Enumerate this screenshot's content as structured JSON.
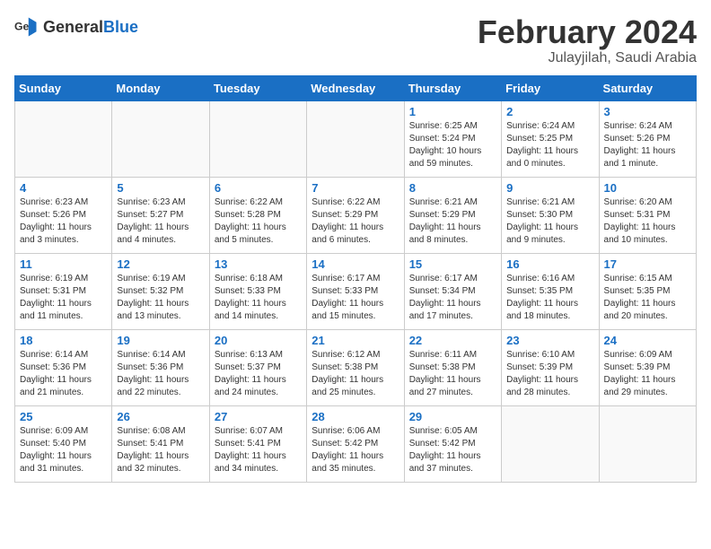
{
  "header": {
    "logo": {
      "general": "General",
      "blue": "Blue"
    },
    "title": "February 2024",
    "location": "Julayjilah, Saudi Arabia"
  },
  "weekdays": [
    "Sunday",
    "Monday",
    "Tuesday",
    "Wednesday",
    "Thursday",
    "Friday",
    "Saturday"
  ],
  "weeks": [
    [
      {
        "day": null
      },
      {
        "day": null
      },
      {
        "day": null
      },
      {
        "day": null
      },
      {
        "day": 1,
        "sunrise": "6:25 AM",
        "sunset": "5:24 PM",
        "daylight": "10 hours and 59 minutes."
      },
      {
        "day": 2,
        "sunrise": "6:24 AM",
        "sunset": "5:25 PM",
        "daylight": "11 hours and 0 minutes."
      },
      {
        "day": 3,
        "sunrise": "6:24 AM",
        "sunset": "5:26 PM",
        "daylight": "11 hours and 1 minute."
      }
    ],
    [
      {
        "day": 4,
        "sunrise": "6:23 AM",
        "sunset": "5:26 PM",
        "daylight": "11 hours and 3 minutes."
      },
      {
        "day": 5,
        "sunrise": "6:23 AM",
        "sunset": "5:27 PM",
        "daylight": "11 hours and 4 minutes."
      },
      {
        "day": 6,
        "sunrise": "6:22 AM",
        "sunset": "5:28 PM",
        "daylight": "11 hours and 5 minutes."
      },
      {
        "day": 7,
        "sunrise": "6:22 AM",
        "sunset": "5:29 PM",
        "daylight": "11 hours and 6 minutes."
      },
      {
        "day": 8,
        "sunrise": "6:21 AM",
        "sunset": "5:29 PM",
        "daylight": "11 hours and 8 minutes."
      },
      {
        "day": 9,
        "sunrise": "6:21 AM",
        "sunset": "5:30 PM",
        "daylight": "11 hours and 9 minutes."
      },
      {
        "day": 10,
        "sunrise": "6:20 AM",
        "sunset": "5:31 PM",
        "daylight": "11 hours and 10 minutes."
      }
    ],
    [
      {
        "day": 11,
        "sunrise": "6:19 AM",
        "sunset": "5:31 PM",
        "daylight": "11 hours and 11 minutes."
      },
      {
        "day": 12,
        "sunrise": "6:19 AM",
        "sunset": "5:32 PM",
        "daylight": "11 hours and 13 minutes."
      },
      {
        "day": 13,
        "sunrise": "6:18 AM",
        "sunset": "5:33 PM",
        "daylight": "11 hours and 14 minutes."
      },
      {
        "day": 14,
        "sunrise": "6:17 AM",
        "sunset": "5:33 PM",
        "daylight": "11 hours and 15 minutes."
      },
      {
        "day": 15,
        "sunrise": "6:17 AM",
        "sunset": "5:34 PM",
        "daylight": "11 hours and 17 minutes."
      },
      {
        "day": 16,
        "sunrise": "6:16 AM",
        "sunset": "5:35 PM",
        "daylight": "11 hours and 18 minutes."
      },
      {
        "day": 17,
        "sunrise": "6:15 AM",
        "sunset": "5:35 PM",
        "daylight": "11 hours and 20 minutes."
      }
    ],
    [
      {
        "day": 18,
        "sunrise": "6:14 AM",
        "sunset": "5:36 PM",
        "daylight": "11 hours and 21 minutes."
      },
      {
        "day": 19,
        "sunrise": "6:14 AM",
        "sunset": "5:36 PM",
        "daylight": "11 hours and 22 minutes."
      },
      {
        "day": 20,
        "sunrise": "6:13 AM",
        "sunset": "5:37 PM",
        "daylight": "11 hours and 24 minutes."
      },
      {
        "day": 21,
        "sunrise": "6:12 AM",
        "sunset": "5:38 PM",
        "daylight": "11 hours and 25 minutes."
      },
      {
        "day": 22,
        "sunrise": "6:11 AM",
        "sunset": "5:38 PM",
        "daylight": "11 hours and 27 minutes."
      },
      {
        "day": 23,
        "sunrise": "6:10 AM",
        "sunset": "5:39 PM",
        "daylight": "11 hours and 28 minutes."
      },
      {
        "day": 24,
        "sunrise": "6:09 AM",
        "sunset": "5:39 PM",
        "daylight": "11 hours and 29 minutes."
      }
    ],
    [
      {
        "day": 25,
        "sunrise": "6:09 AM",
        "sunset": "5:40 PM",
        "daylight": "11 hours and 31 minutes."
      },
      {
        "day": 26,
        "sunrise": "6:08 AM",
        "sunset": "5:41 PM",
        "daylight": "11 hours and 32 minutes."
      },
      {
        "day": 27,
        "sunrise": "6:07 AM",
        "sunset": "5:41 PM",
        "daylight": "11 hours and 34 minutes."
      },
      {
        "day": 28,
        "sunrise": "6:06 AM",
        "sunset": "5:42 PM",
        "daylight": "11 hours and 35 minutes."
      },
      {
        "day": 29,
        "sunrise": "6:05 AM",
        "sunset": "5:42 PM",
        "daylight": "11 hours and 37 minutes."
      },
      {
        "day": null
      },
      {
        "day": null
      }
    ]
  ]
}
